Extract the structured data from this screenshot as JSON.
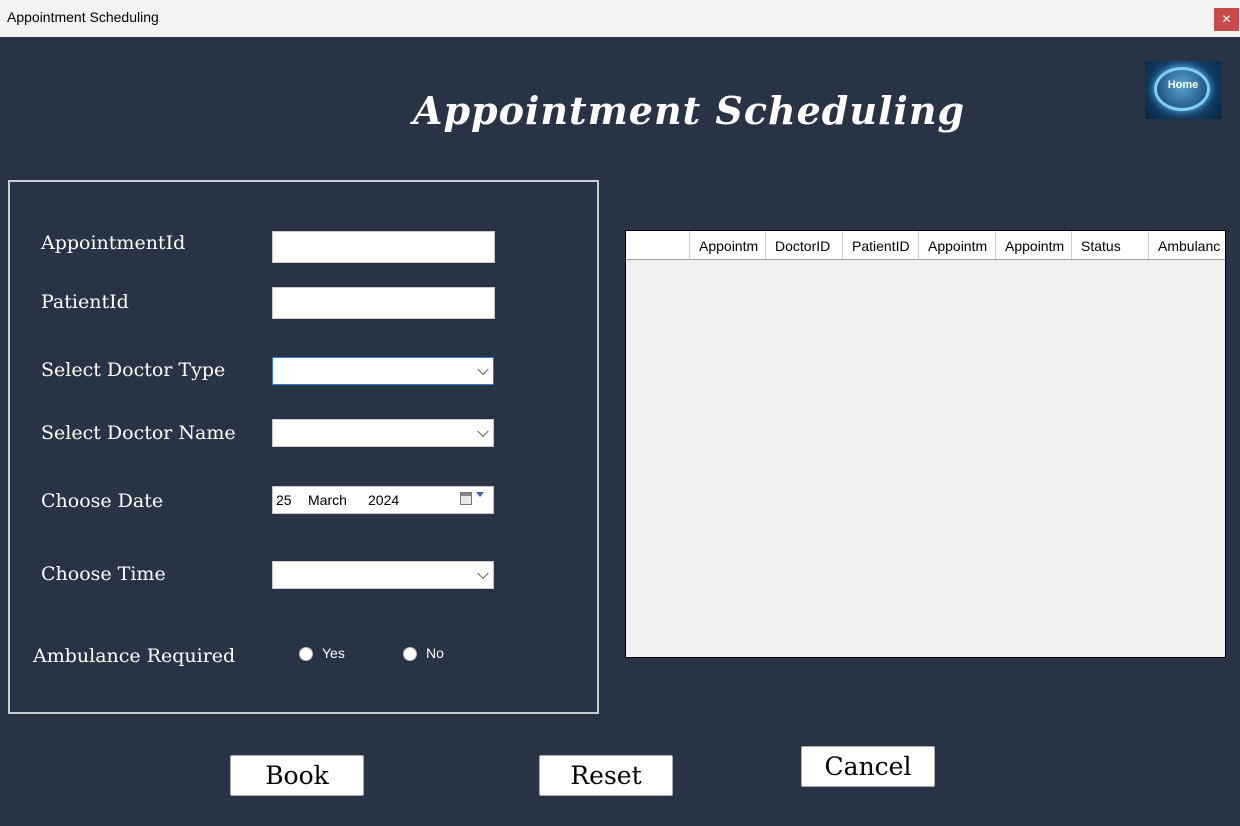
{
  "window": {
    "title": "Appointment Scheduling",
    "close_glyph": "✕"
  },
  "header": {
    "title": "Appointment Scheduling",
    "home_label": "Home"
  },
  "form": {
    "appointment_id_label": "AppointmentId",
    "appointment_id_value": "",
    "patient_id_label": "PatientId",
    "patient_id_value": "",
    "doctor_type_label": "Select Doctor Type",
    "doctor_type_value": "",
    "doctor_name_label": "Select Doctor Name",
    "doctor_name_value": "",
    "date_label": "Choose Date",
    "date": {
      "day": "25",
      "month": "March",
      "year": "2024"
    },
    "time_label": "Choose Time",
    "time_value": "",
    "ambulance_label": "Ambulance Required",
    "ambulance_options": [
      "Yes",
      "No"
    ]
  },
  "table": {
    "columns": [
      "Appointm",
      "DoctorID",
      "PatientID",
      "Appointm",
      "Appointm",
      "Status",
      "Ambulanc"
    ],
    "rows": []
  },
  "buttons": {
    "book": "Book",
    "reset": "Reset",
    "cancel": "Cancel"
  },
  "colors": {
    "background": "#283445",
    "close": "#c94a4a",
    "focus_border": "#2f78d4"
  }
}
